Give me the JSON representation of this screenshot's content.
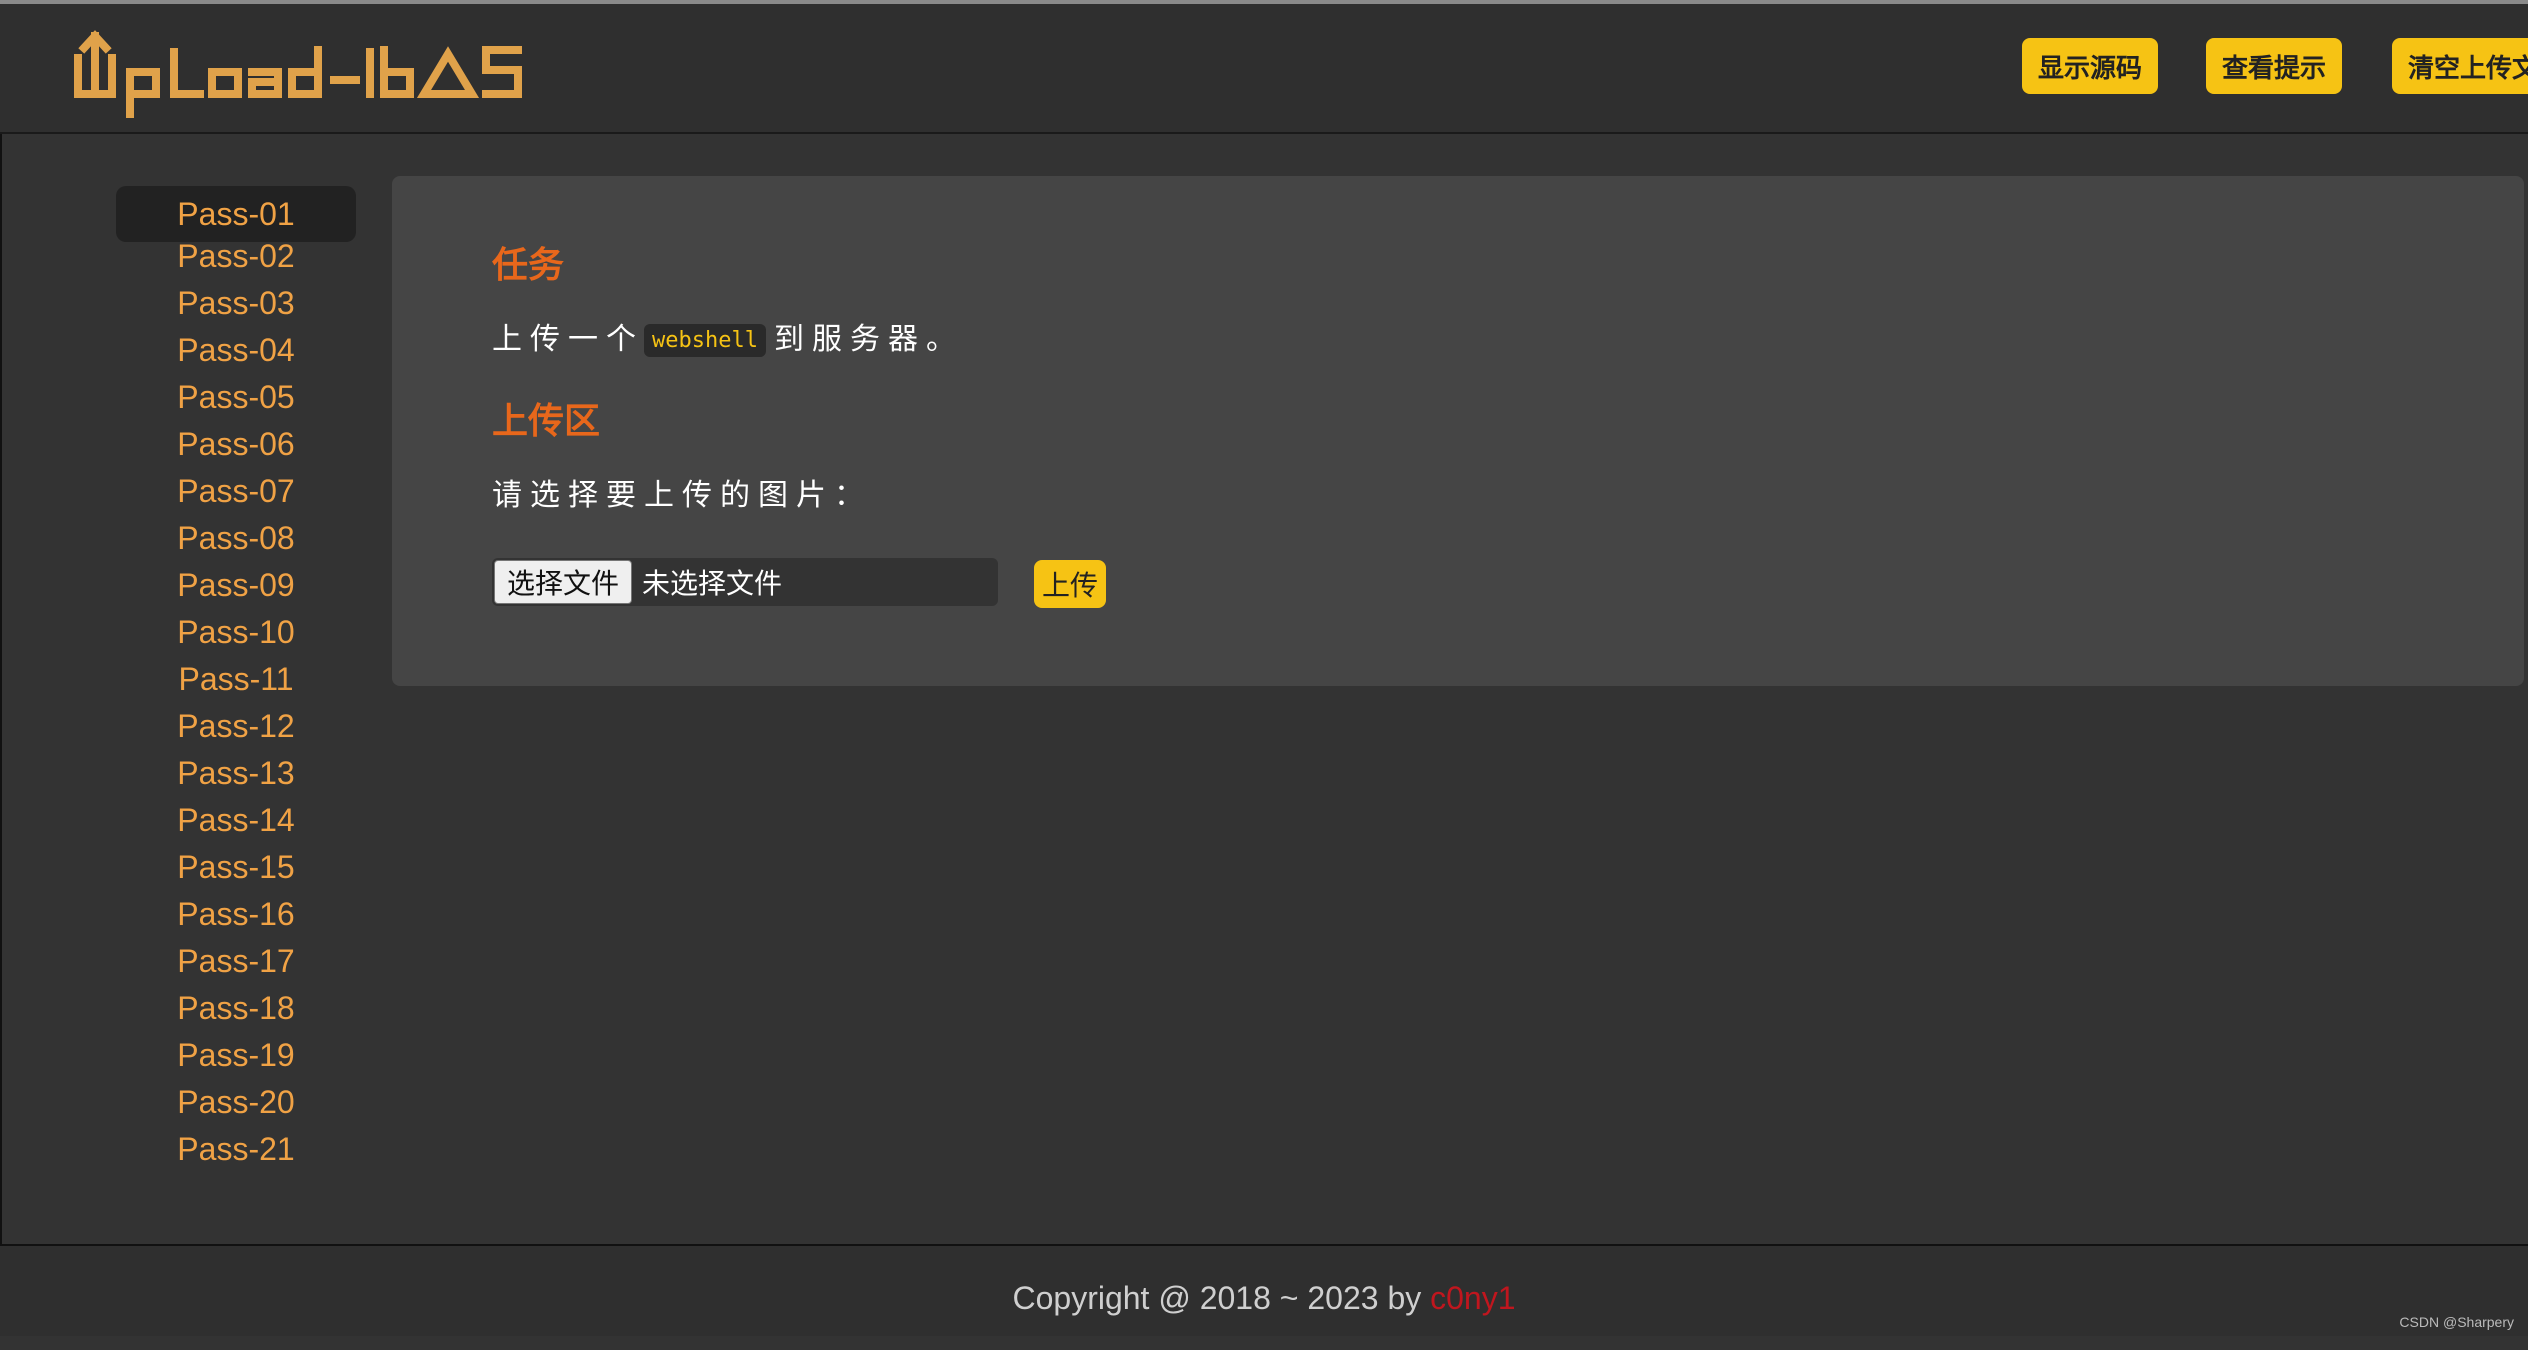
{
  "header": {
    "logo_text": "UpLoad-labS",
    "buttons": [
      "显示源码",
      "查看提示",
      "清空上传文件"
    ]
  },
  "sidebar": {
    "items": [
      "Pass-01",
      "Pass-02",
      "Pass-03",
      "Pass-04",
      "Pass-05",
      "Pass-06",
      "Pass-07",
      "Pass-08",
      "Pass-09",
      "Pass-10",
      "Pass-11",
      "Pass-12",
      "Pass-13",
      "Pass-14",
      "Pass-15",
      "Pass-16",
      "Pass-17",
      "Pass-18",
      "Pass-19",
      "Pass-20",
      "Pass-21"
    ],
    "active_index": 0
  },
  "main": {
    "task_title": "任务",
    "task_prefix": "上传一个",
    "task_code": "webshell",
    "task_suffix": "到服务器。",
    "upload_title": "上传区",
    "upload_prompt": "请选择要上传的图片：",
    "file_button": "选择文件",
    "file_status": "未选择文件",
    "upload_button": "上传"
  },
  "footer": {
    "copyright": "Copyright @ 2018 ~ 2023 by ",
    "author": "c0ny1"
  },
  "watermark": "CSDN @Sharpery",
  "colors": {
    "accent": "#f6c314",
    "heading": "#e8671b",
    "sidebar_link": "#f0a245",
    "author": "#c0161e"
  }
}
